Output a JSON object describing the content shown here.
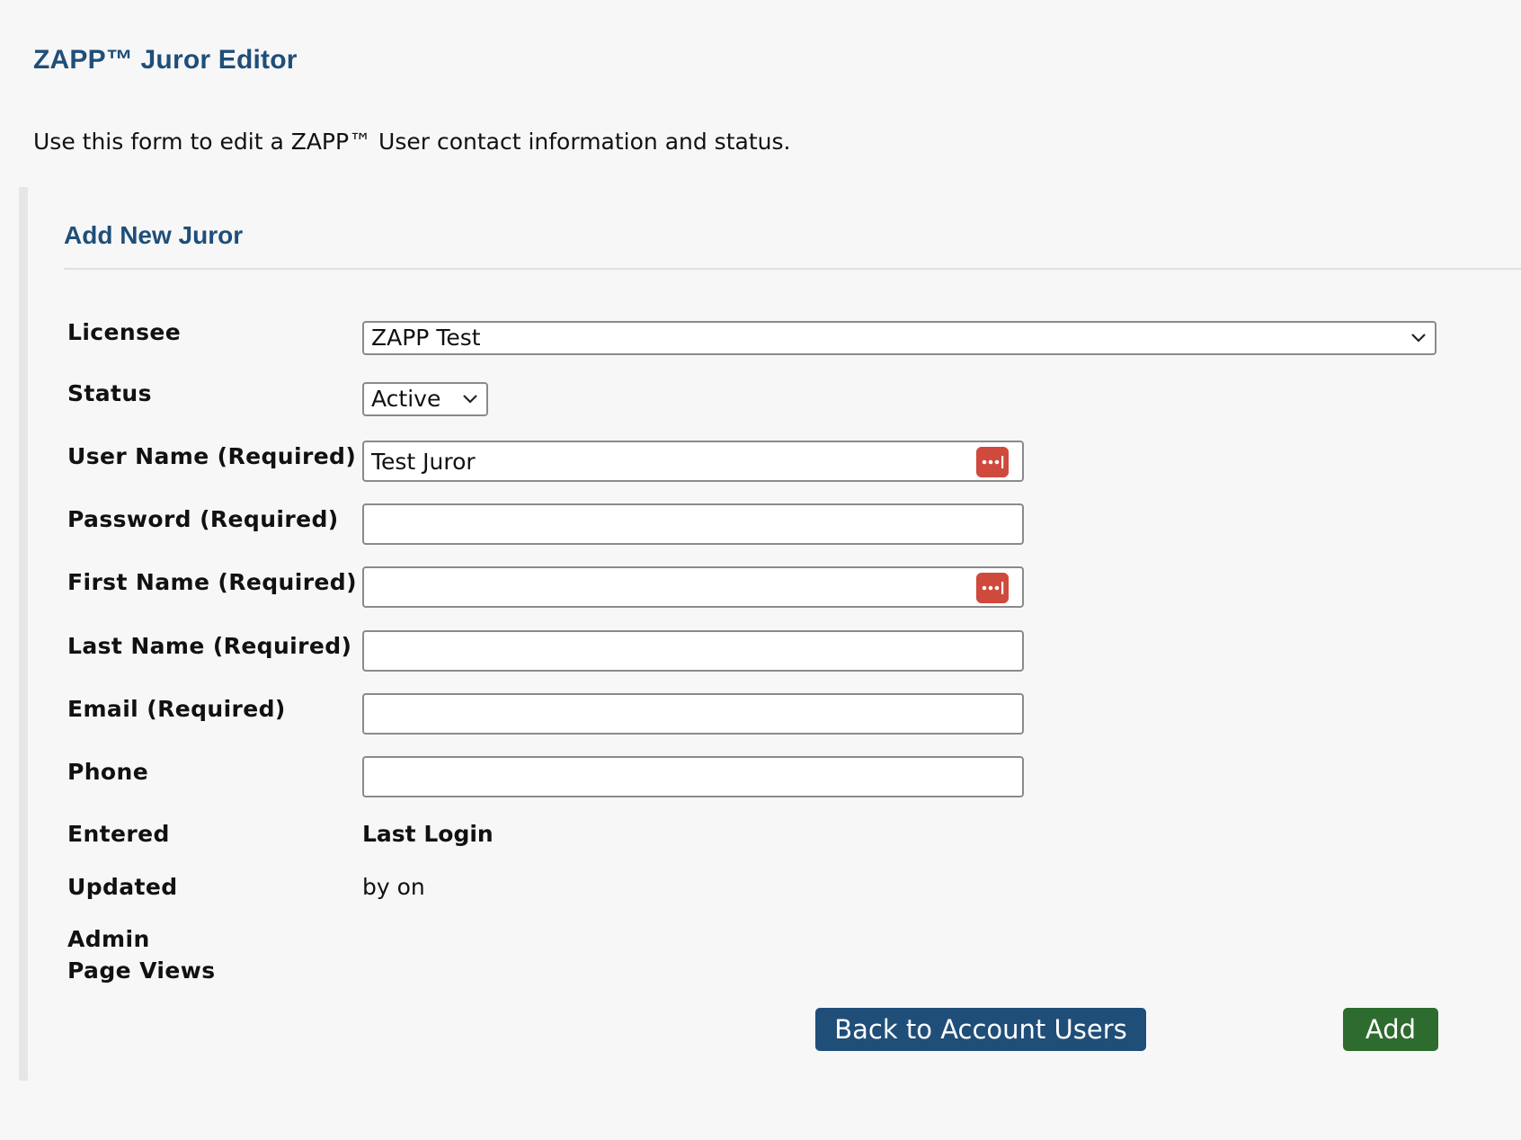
{
  "page": {
    "title": "ZAPP™ Juror Editor",
    "intro": "Use this form to edit a ZAPP™ User contact information and status."
  },
  "panel": {
    "title": "Add New Juror"
  },
  "form": {
    "licensee_label": "Licensee",
    "licensee_value": "ZAPP Test",
    "status_label": "Status",
    "status_value": "Active",
    "username_label": "User Name (Required)",
    "username_value": "Test Juror",
    "password_label": "Password (Required)",
    "password_value": "",
    "first_name_label": "First Name (Required)",
    "first_name_value": "",
    "last_name_label": "Last Name (Required)",
    "last_name_value": "",
    "email_label": "Email (Required)",
    "email_value": "",
    "phone_label": "Phone",
    "phone_value": "",
    "entered_label": "Entered",
    "last_login_label": "Last Login",
    "updated_label": "Updated",
    "updated_value": "by on",
    "admin_page_views_label_line1": "Admin",
    "admin_page_views_label_line2": "Page Views"
  },
  "buttons": {
    "back": "Back to Account Users",
    "add": "Add"
  },
  "icons": {
    "select_chevron": "chevron-down-icon",
    "password_manager": "password-manager-icon"
  },
  "colors": {
    "title_blue": "#1f4e79",
    "back_button": "#1f4e79",
    "add_button": "#2e6b2e",
    "password_manager_icon": "#cf4a3c",
    "page_background": "#f7f7f7"
  }
}
